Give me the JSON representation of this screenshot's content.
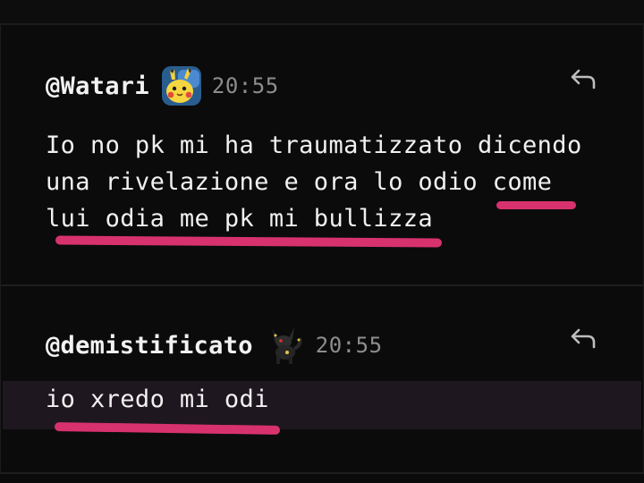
{
  "messages": [
    {
      "author": "@Watari",
      "avatar_icon": "pikachu-avatar-icon",
      "time": "20:55",
      "lines": [
        "Io no pk mi ha traumatizzato dicendo",
        "una rivelazione e ora lo odio come",
        "lui odia me pk mi bullizza"
      ],
      "reply_icon": "reply-arrow-icon"
    },
    {
      "author": "@demistificato",
      "avatar_icon": "umbreon-avatar-icon",
      "time": "20:55",
      "lines": [
        "io xredo mi odi"
      ],
      "reply_icon": "reply-arrow-icon",
      "highlighted": true
    }
  ],
  "colors": {
    "background": "#0b0b0b",
    "text": "#f1f1f1",
    "timestamp": "#8d8d8d",
    "highlight": "#1f171f",
    "annotation_underline": "#d7326e"
  }
}
